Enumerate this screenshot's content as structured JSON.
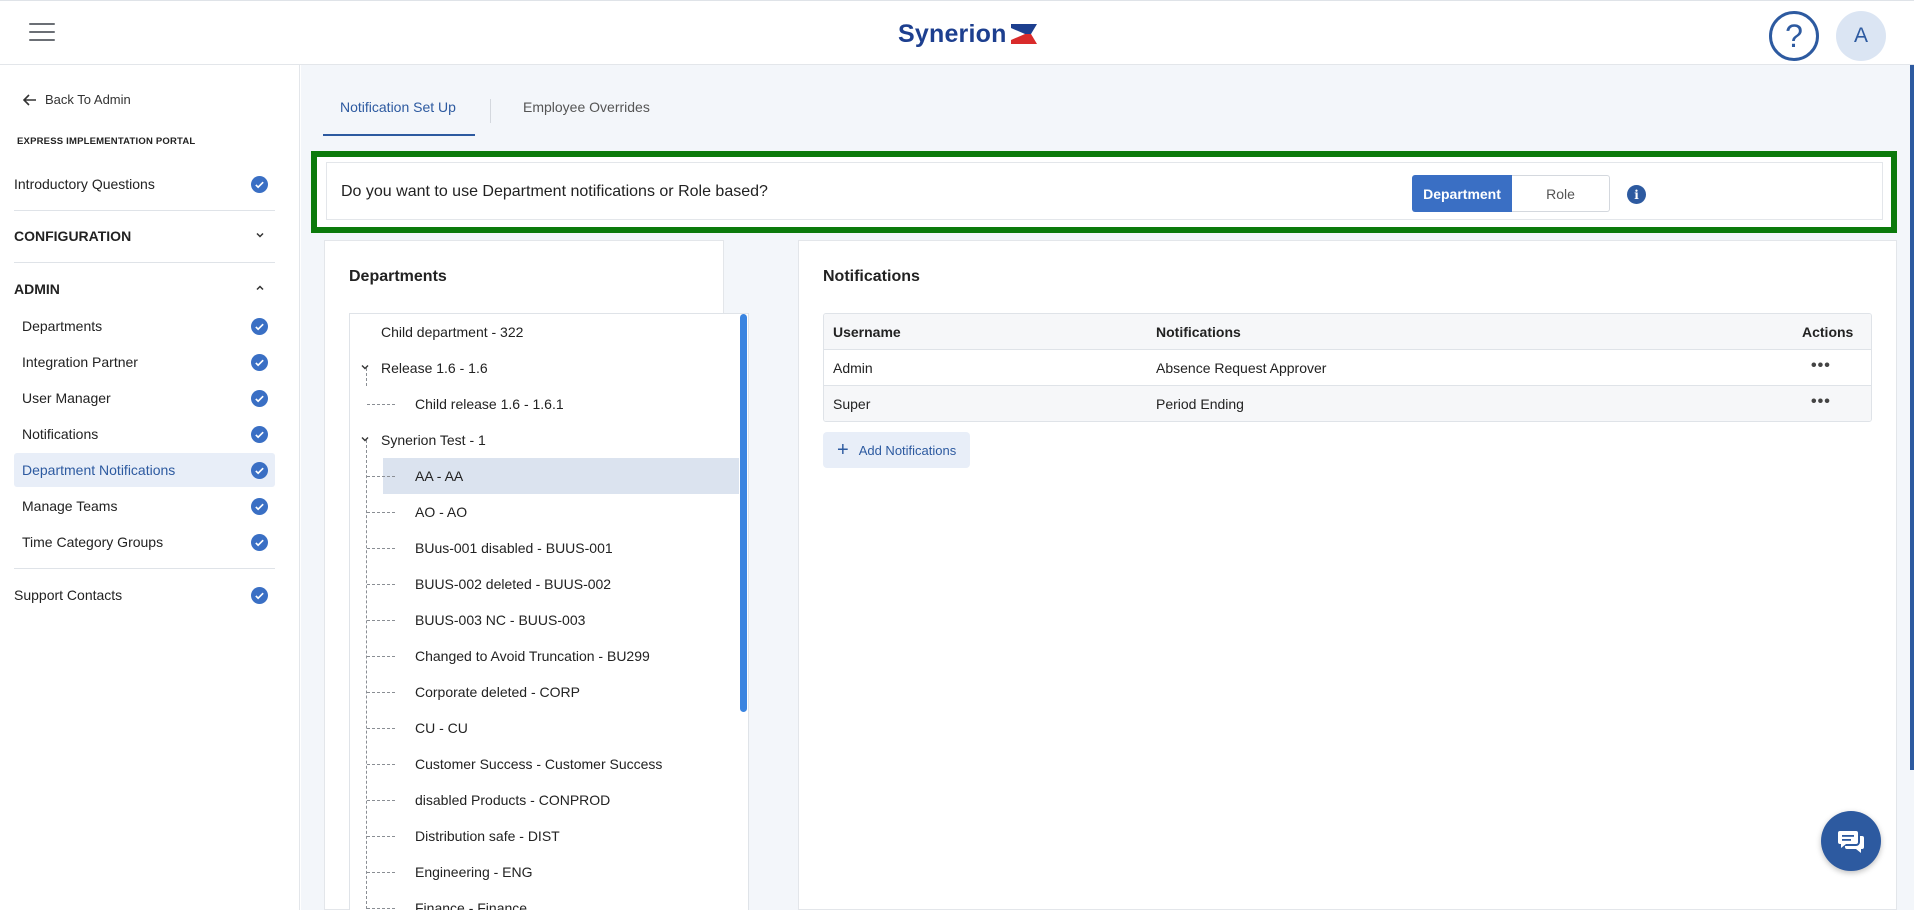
{
  "header": {
    "logo_text": "Synerion",
    "help_symbol": "?",
    "avatar_initial": "A",
    "brand_color": "#1d3f8f"
  },
  "sidebar": {
    "back_label": "Back To Admin",
    "portal_title": "EXPRESS IMPLEMENTATION PORTAL",
    "intro": "Introductory Questions",
    "configuration": "CONFIGURATION",
    "admin": "ADMIN",
    "admin_items": [
      {
        "label": "Departments",
        "done": true
      },
      {
        "label": "Integration Partner",
        "done": true
      },
      {
        "label": "User Manager",
        "done": true
      },
      {
        "label": "Notifications",
        "done": true
      },
      {
        "label": "Department Notifications",
        "done": true,
        "active": true
      },
      {
        "label": "Manage Teams",
        "done": true
      },
      {
        "label": "Time Category Groups",
        "done": true
      }
    ],
    "support": "Support Contacts"
  },
  "tabs": [
    {
      "label": "Notification Set Up",
      "active": true
    },
    {
      "label": "Employee Overrides",
      "active": false
    }
  ],
  "question": {
    "text": "Do you want to use Department notifications or Role based?",
    "option_department": "Department",
    "option_role": "Role",
    "selected": "Department",
    "info_symbol": "i",
    "highlight_color": "#0b7a0b"
  },
  "departments": {
    "title": "Departments",
    "items": [
      {
        "label": "Child department - 322",
        "level": 0
      },
      {
        "label": "Release 1.6 - 1.6",
        "level": 0,
        "expanded": true
      },
      {
        "label": "Child release 1.6 - 1.6.1",
        "level": 1
      },
      {
        "label": "Synerion Test - 1",
        "level": 0,
        "expanded": true
      },
      {
        "label": "AA - AA",
        "level": 1,
        "selected": true
      },
      {
        "label": "AO - AO",
        "level": 1
      },
      {
        "label": "BUus-001 disabled - BUUS-001",
        "level": 1
      },
      {
        "label": "BUUS-002 deleted - BUUS-002",
        "level": 1
      },
      {
        "label": "BUUS-003 NC - BUUS-003",
        "level": 1
      },
      {
        "label": "Changed to Avoid Truncation - BU299",
        "level": 1
      },
      {
        "label": "Corporate deleted - CORP",
        "level": 1
      },
      {
        "label": "CU - CU",
        "level": 1
      },
      {
        "label": "Customer Success - Customer Success",
        "level": 1
      },
      {
        "label": "disabled Products - CONPROD",
        "level": 1
      },
      {
        "label": "Distribution safe - DIST",
        "level": 1
      },
      {
        "label": "Engineering - ENG",
        "level": 1
      },
      {
        "label": "Finance - Finance",
        "level": 1
      }
    ]
  },
  "notifications": {
    "title": "Notifications",
    "columns": [
      "Username",
      "Notifications",
      "Actions"
    ],
    "rows": [
      {
        "username": "Admin",
        "notification": "Absence Request Approver",
        "actions": "•••"
      },
      {
        "username": "Super",
        "notification": "Period Ending",
        "actions": "•••"
      }
    ],
    "add_label": "Add Notifications",
    "add_symbol": "+"
  },
  "icons": {
    "menu": "hamburger-icon",
    "back": "arrow-left-icon",
    "check": "check-circle-icon",
    "chat": "chat-icon"
  }
}
